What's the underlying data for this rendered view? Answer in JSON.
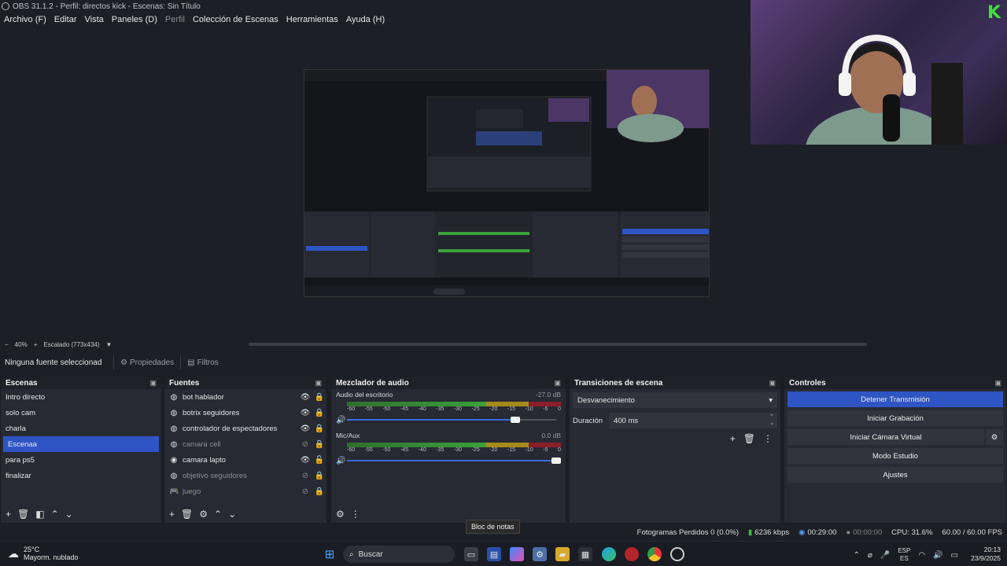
{
  "window": {
    "title": "OBS 31.1.2 - Perfil: directos kick - Escenas: Sin Título"
  },
  "menu": [
    {
      "label": "Archivo (F)",
      "dim": false
    },
    {
      "label": "Editar",
      "dim": false
    },
    {
      "label": "Vista",
      "dim": false
    },
    {
      "label": "Paneles (D)",
      "dim": false
    },
    {
      "label": "Perfil",
      "dim": true
    },
    {
      "label": "Colección de Escenas",
      "dim": false
    },
    {
      "label": "Herramientas",
      "dim": false
    },
    {
      "label": "Ayuda (H)",
      "dim": false
    }
  ],
  "zoom": {
    "minus": "−",
    "level": "40%",
    "plus": "+",
    "scaling": "Escalado (773x434)"
  },
  "source_bar": {
    "no_source": "Ninguna fuente seleccionad",
    "properties": "Propiedades",
    "filters": "Filtros"
  },
  "scenes": {
    "title": "Escenas",
    "items": [
      {
        "label": "Intro directo",
        "selected": false
      },
      {
        "label": "solo cam",
        "selected": false
      },
      {
        "label": "charla",
        "selected": false
      },
      {
        "label": "Escenaa",
        "selected": true
      },
      {
        "label": "para ps5",
        "selected": false
      },
      {
        "label": "finalizar",
        "selected": false
      }
    ]
  },
  "sources": {
    "title": "Fuentes",
    "items": [
      {
        "label": "bot hablador",
        "icon": "globe-icon",
        "visible": true
      },
      {
        "label": "botrix seguidores",
        "icon": "globe-icon",
        "visible": true
      },
      {
        "label": "controlador de espectadores",
        "icon": "globe-icon",
        "visible": true
      },
      {
        "label": "camara cell",
        "icon": "globe-icon",
        "visible": false
      },
      {
        "label": "camara lapto",
        "icon": "camera-icon",
        "visible": true
      },
      {
        "label": "objetivo seguidores",
        "icon": "globe-icon",
        "visible": false
      },
      {
        "label": "juego",
        "icon": "gamepad-icon",
        "visible": false
      }
    ]
  },
  "mixer": {
    "title": "Mezclador de audio",
    "channels": [
      {
        "name": "Audio del escritorio",
        "db": "-27.0 dB",
        "volume": 0.8
      },
      {
        "name": "Mic/Aux",
        "db": "0.0 dB",
        "volume": 1.0
      }
    ],
    "ticks": [
      "-60",
      "-55",
      "-50",
      "-45",
      "-40",
      "-35",
      "-30",
      "-25",
      "-20",
      "-15",
      "-10",
      "-5",
      "0"
    ]
  },
  "transitions": {
    "title": "Transiciones de escena",
    "selected": "Desvanecimiento",
    "duration_label": "Duración",
    "duration_value": "400 ms"
  },
  "controls": {
    "title": "Controles",
    "stop_stream": "Detener Transmisión",
    "start_recording": "Iniciar Grabación",
    "start_virtual_cam": "Iniciar Cámara Virtual",
    "studio_mode": "Modo Estudio",
    "settings": "Ajustes"
  },
  "tooltip": "Bloc de notas",
  "status": {
    "dropped": "Fotogramas Perdidos 0 (0.0%)",
    "bitrate": "6236 kbps",
    "stream_time": "00:29:00",
    "rec_time": "00:00:00",
    "cpu": "CPU: 31.6%",
    "fps": "60.00 / 60.00 FPS"
  },
  "taskbar": {
    "weather_temp": "25°C",
    "weather_desc": "Mayorm. nublado",
    "search_placeholder": "Buscar",
    "lang1": "ESP",
    "lang2": "ES",
    "time": "20:13",
    "date": "23/9/2025"
  },
  "colors": {
    "accent": "#2f55c4",
    "panel": "#272a33",
    "bg": "#1d1f26"
  }
}
